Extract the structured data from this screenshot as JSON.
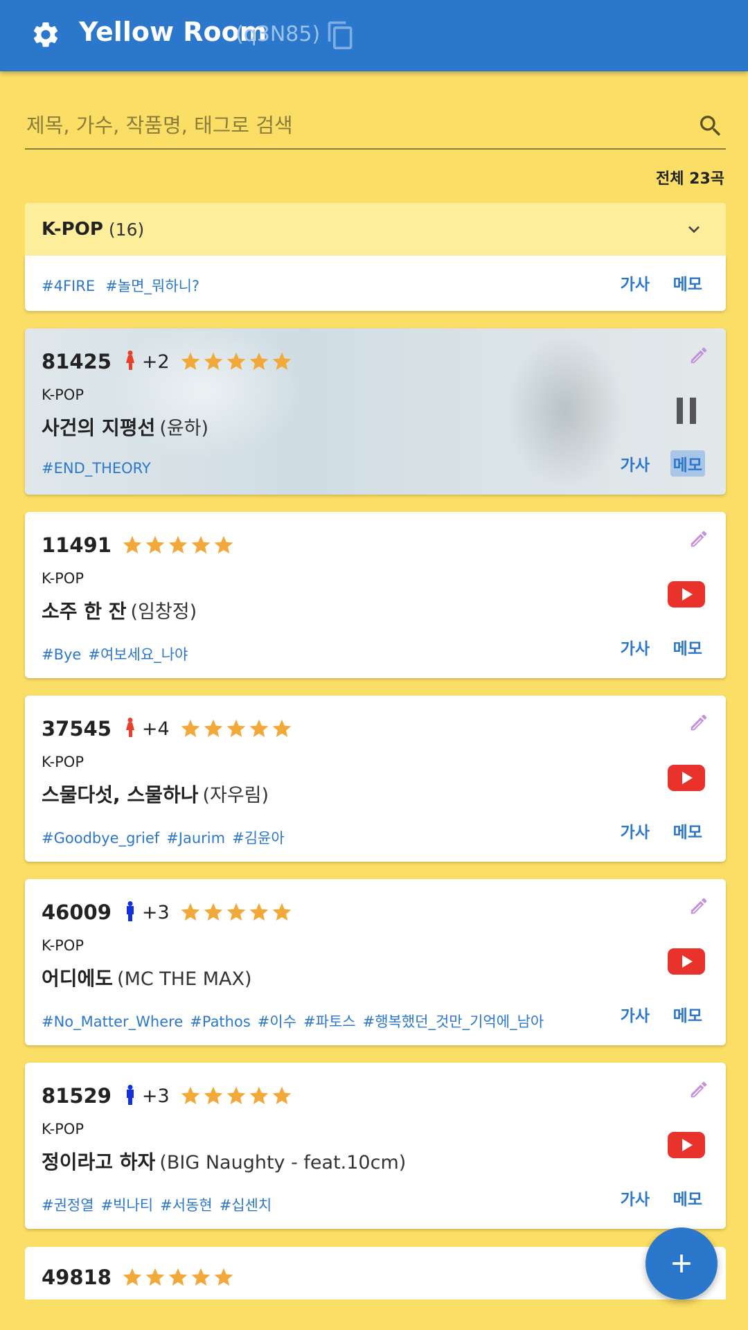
{
  "appbar": {
    "title": "Yellow Room",
    "room_code": "(q3N85)"
  },
  "search": {
    "placeholder": "제목, 가수, 작품명, 태그로 검색"
  },
  "total_label": "전체 23곡",
  "category": {
    "name": "K-POP",
    "count": "(16)"
  },
  "buttons": {
    "lyrics": "가사",
    "memo": "메모"
  },
  "partial_top": {
    "tags": [
      "#4FIRE",
      "#놀면_뭐하니?"
    ]
  },
  "songs": [
    {
      "number": "81425",
      "gender": "female",
      "plus": "+2",
      "genre": "K-POP",
      "title": "사건의 지평선",
      "artist": "(윤하)",
      "tags": [
        "#END_THEORY"
      ],
      "status": "playing",
      "rating": 5
    },
    {
      "number": "11491",
      "gender": "none",
      "plus": "",
      "genre": "K-POP",
      "title": "소주 한 잔",
      "artist": "(임창정)",
      "tags": [
        "#Bye",
        "#여보세요_나야"
      ],
      "status": "youtube",
      "rating": 5
    },
    {
      "number": "37545",
      "gender": "female",
      "plus": "+4",
      "genre": "K-POP",
      "title": "스물다섯, 스물하나",
      "artist": "(자우림)",
      "tags": [
        "#Goodbye_grief",
        "#Jaurim",
        "#김윤아"
      ],
      "status": "youtube",
      "rating": 5
    },
    {
      "number": "46009",
      "gender": "male",
      "plus": "+3",
      "genre": "K-POP",
      "title": "어디에도",
      "artist": "(MC THE MAX)",
      "tags": [
        "#No_Matter_Where",
        "#Pathos",
        "#이수",
        "#파토스",
        "#행복했던_것만_기억에_남아"
      ],
      "status": "youtube",
      "rating": 5
    },
    {
      "number": "81529",
      "gender": "male",
      "plus": "+3",
      "genre": "K-POP",
      "title": "정이라고 하자",
      "artist": "(BIG Naughty - feat.10cm)",
      "tags": [
        "#권정열",
        "#빅나티",
        "#서동현",
        "#십센치"
      ],
      "status": "youtube",
      "rating": 5
    }
  ],
  "partial_bottom": {
    "number": "49818",
    "rating": 5
  },
  "colors": {
    "appbar": "#2b77cb",
    "background": "#fbde65",
    "star": "#f3a93a",
    "youtube": "#e8322b",
    "female": "#e8402d",
    "male": "#1330e0",
    "tag": "#2b77cb",
    "pencil": "#c48fdd"
  },
  "icons": {
    "settings": "gear-icon",
    "copy": "copy-icon",
    "search": "search-icon",
    "expand": "chevron-down-icon",
    "edit": "pencil-icon",
    "pause": "pause-icon",
    "youtube": "youtube-icon",
    "add": "plus-icon"
  }
}
